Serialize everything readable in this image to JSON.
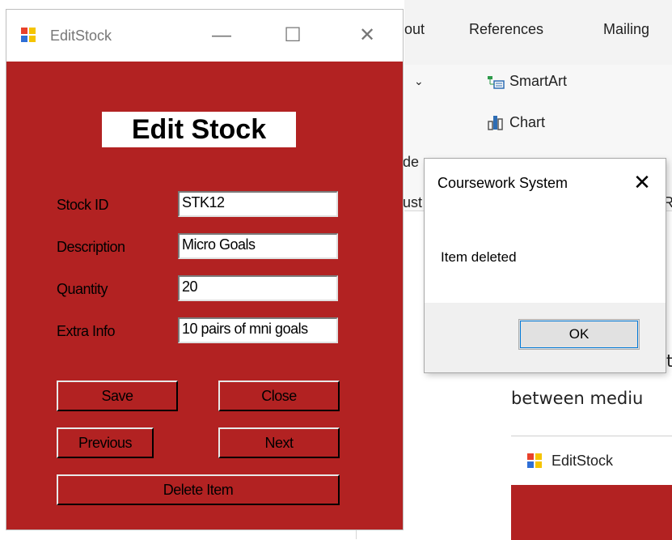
{
  "word": {
    "ribbon_tabs": [
      "out",
      "References",
      "Mailing"
    ],
    "ribbon_items": {
      "dropdown_caret": "⌄",
      "smartart": "SmartArt",
      "chart": "Chart",
      "partial_de": "de",
      "partial_ust": "ust",
      "partial_r": "R"
    },
    "doc_text_partial_t": "t",
    "doc_text": "between mediu",
    "embedded_window_title": "EditStock"
  },
  "edit_stock": {
    "window_title": "EditStock",
    "heading": "Edit Stock",
    "fields": [
      {
        "label": "Stock ID",
        "value": "STK12"
      },
      {
        "label": "Description",
        "value": "Micro Goals"
      },
      {
        "label": "Quantity",
        "value": "20"
      },
      {
        "label": "Extra Info",
        "value": "10 pairs of mni goals"
      }
    ],
    "buttons": {
      "save": "Save",
      "close": "Close",
      "previous": "Previous",
      "next": "Next",
      "delete": "Delete Item"
    },
    "window_controls": {
      "minimize": "—",
      "maximize": "☐",
      "close": "✕"
    }
  },
  "message_box": {
    "title": "Coursework System",
    "close_glyph": "✕",
    "message": "Item deleted",
    "ok_label": "OK"
  },
  "colors": {
    "form_background": "#b22222",
    "icon_red": "#e8412b",
    "icon_yellow": "#f5c400",
    "icon_blue": "#2f6fd6",
    "focus_blue": "#0078d7"
  }
}
